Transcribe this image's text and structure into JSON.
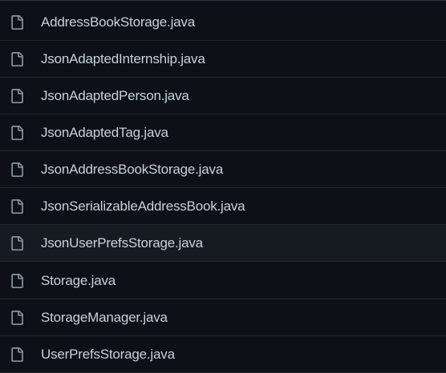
{
  "colors": {
    "background": "#0d1117",
    "row_hover_background": "#161b22",
    "divider": "#21262d",
    "text": "#c9d1d9",
    "icon": "#8b949e"
  },
  "files": [
    {
      "name": "AddressBookStorage.java",
      "icon": "file-icon"
    },
    {
      "name": "JsonAdaptedInternship.java",
      "icon": "file-icon"
    },
    {
      "name": "JsonAdaptedPerson.java",
      "icon": "file-icon"
    },
    {
      "name": "JsonAdaptedTag.java",
      "icon": "file-icon"
    },
    {
      "name": "JsonAddressBookStorage.java",
      "icon": "file-icon"
    },
    {
      "name": "JsonSerializableAddressBook.java",
      "icon": "file-icon"
    },
    {
      "name": "JsonUserPrefsStorage.java",
      "icon": "file-icon",
      "hovered": true
    },
    {
      "name": "Storage.java",
      "icon": "file-icon"
    },
    {
      "name": "StorageManager.java",
      "icon": "file-icon"
    },
    {
      "name": "UserPrefsStorage.java",
      "icon": "file-icon"
    }
  ]
}
